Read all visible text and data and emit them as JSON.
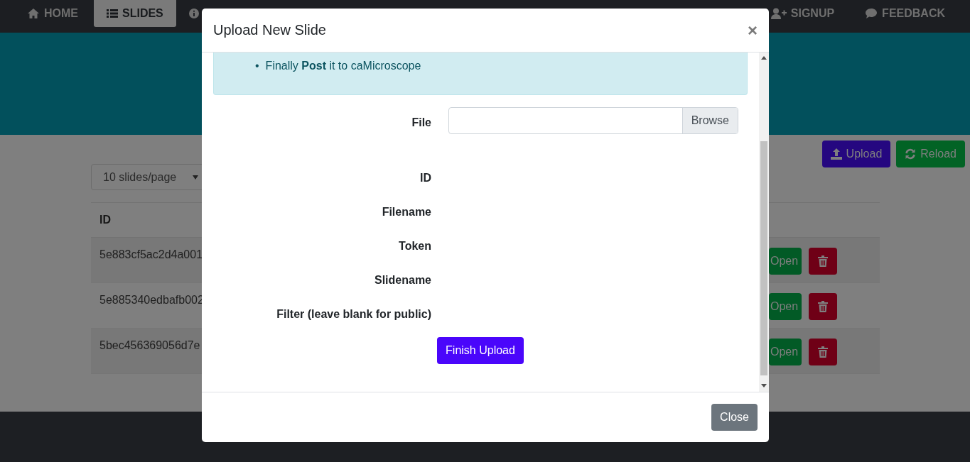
{
  "navbar": {
    "tabs": [
      {
        "label": "HOME",
        "kind": "home",
        "selected": false
      },
      {
        "label": "SLIDES",
        "kind": "list",
        "selected": true
      },
      {
        "label": "SIGNUP",
        "kind": "signup",
        "selected": false
      },
      {
        "label": "FEEDBACK",
        "kind": "feedback",
        "selected": false
      }
    ]
  },
  "toolbar": {
    "buttons": [
      {
        "label": "Upload",
        "kind": "upload"
      },
      {
        "label": "Reload",
        "kind": "reload"
      }
    ]
  },
  "page_size_select": {
    "value": "10 slides/page"
  },
  "table": {
    "columns": [
      "ID"
    ],
    "rows": [
      {
        "id": "5e883cf5ac2d4a001",
        "action": "Open"
      },
      {
        "id": "5e885340edbafb002",
        "action": "Open"
      },
      {
        "id": "5bec456369056d7e",
        "action": "Open"
      }
    ]
  },
  "modal": {
    "title": "Upload New Slide",
    "close_symbol": "×",
    "info_items": [
      {
        "bullet": "•",
        "text": "Finally **Post** it to caMicroscope"
      }
    ],
    "fields": [
      {
        "label": "File",
        "kind": "file",
        "button": "Browse"
      },
      {
        "label": "ID",
        "kind": "text"
      },
      {
        "label": "Filename",
        "kind": "text"
      },
      {
        "label": "Token",
        "kind": "text"
      },
      {
        "label": "Slidename",
        "kind": "text"
      },
      {
        "label": "Filter (leave blank for public)",
        "kind": "text"
      }
    ],
    "submit": "Finish Upload",
    "footer_button": "Close"
  }
}
